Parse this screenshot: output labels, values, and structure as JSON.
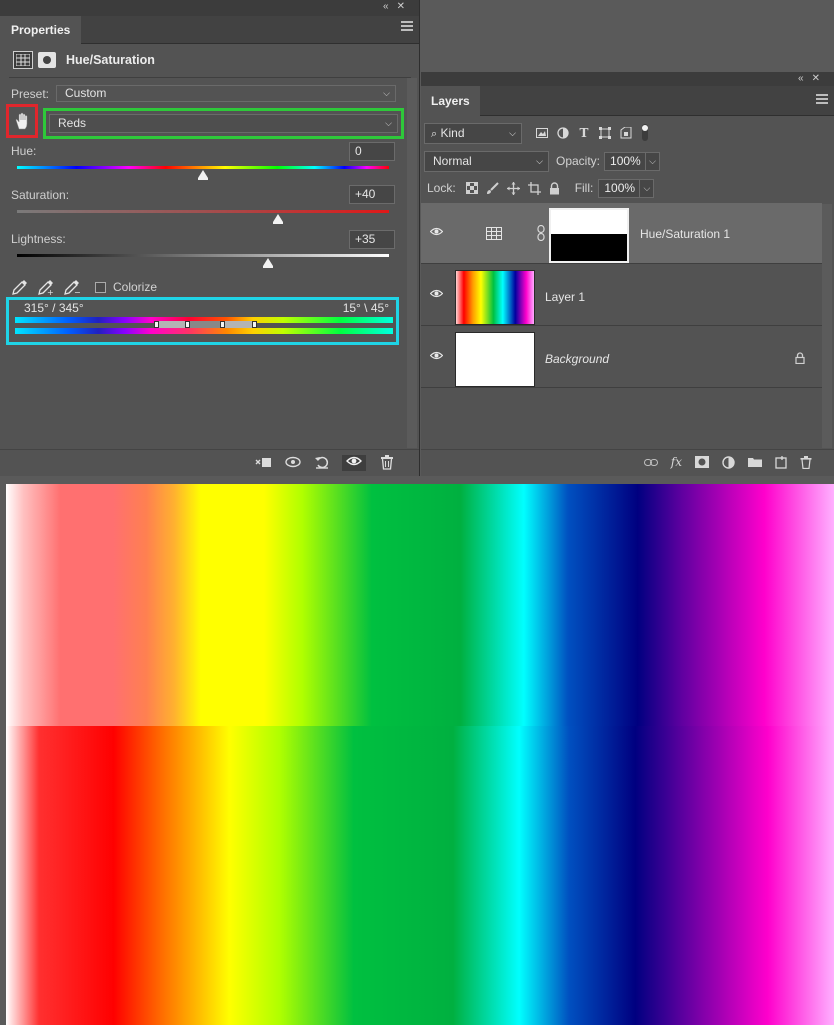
{
  "properties": {
    "tab_label": "Properties",
    "panel_title": "Hue/Saturation",
    "preset_label": "Preset:",
    "preset_value": "Custom",
    "channel_value": "Reds",
    "hue_label": "Hue:",
    "hue_value": "0",
    "saturation_label": "Saturation:",
    "saturation_value": "+40",
    "lightness_label": "Lightness:",
    "lightness_value": "+35",
    "colorize_label": "Colorize",
    "range_left": "315° / 345°",
    "range_right": "15° \\ 45°",
    "colors": {
      "red_highlight": "#e0262c",
      "green_highlight": "#2ec83a",
      "cyan_highlight": "#1fd4e6"
    }
  },
  "layers_panel": {
    "tab_label": "Layers",
    "filter_label": "Kind",
    "blend_mode": "Normal",
    "opacity_label": "Opacity:",
    "opacity_value": "100%",
    "lock_label": "Lock:",
    "fill_label": "Fill:",
    "fill_value": "100%",
    "layers": [
      {
        "name": "Hue/Saturation 1",
        "selected": true
      },
      {
        "name": "Layer 1",
        "selected": false
      },
      {
        "name": "Background",
        "selected": false
      }
    ]
  }
}
